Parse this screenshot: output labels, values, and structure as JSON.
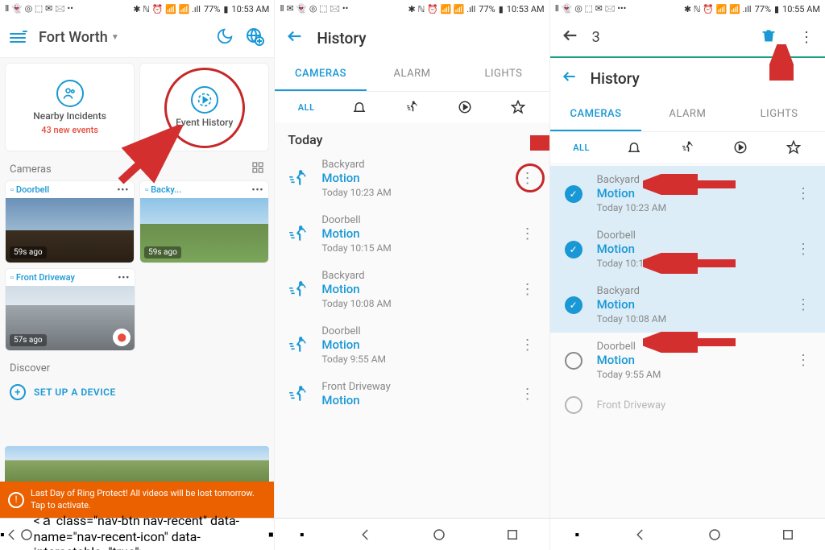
{
  "status": {
    "time1": "10:53 AM",
    "time2": "10:53 AM",
    "time3": "10:55 AM",
    "battery": "77%"
  },
  "screen1": {
    "location": "Fort Worth",
    "card1": {
      "label": "Nearby Incidents",
      "sub": "43 new events"
    },
    "card2": {
      "label": "Event History"
    },
    "cameras_label": "Cameras",
    "cams": [
      {
        "name": "Doorbell",
        "badge": "59s ago"
      },
      {
        "name": "Backy...",
        "badge": "59s ago"
      },
      {
        "name": "Front Driveway",
        "badge": "57s ago"
      }
    ],
    "discover": "Discover",
    "setup": "SET UP A DEVICE",
    "banner": "Last Day of Ring Protect! All videos will be lost tomorrow. Tap to activate."
  },
  "history": {
    "title": "History",
    "tabs": {
      "cameras": "CAMERAS",
      "alarm": "ALARM",
      "lights": "LIGHTS"
    },
    "filters": {
      "all": "ALL"
    },
    "today": "Today"
  },
  "events": [
    {
      "name": "Backyard",
      "type": "Motion",
      "time": "Today 10:23 AM"
    },
    {
      "name": "Doorbell",
      "type": "Motion",
      "time": "Today 10:15 AM"
    },
    {
      "name": "Backyard",
      "type": "Motion",
      "time": "Today 10:08 AM"
    },
    {
      "name": "Doorbell",
      "type": "Motion",
      "time": "Today 9:55 AM"
    },
    {
      "name": "Front Driveway",
      "type": "Motion",
      "time": ""
    }
  ],
  "screen3": {
    "selected_count": "3"
  }
}
